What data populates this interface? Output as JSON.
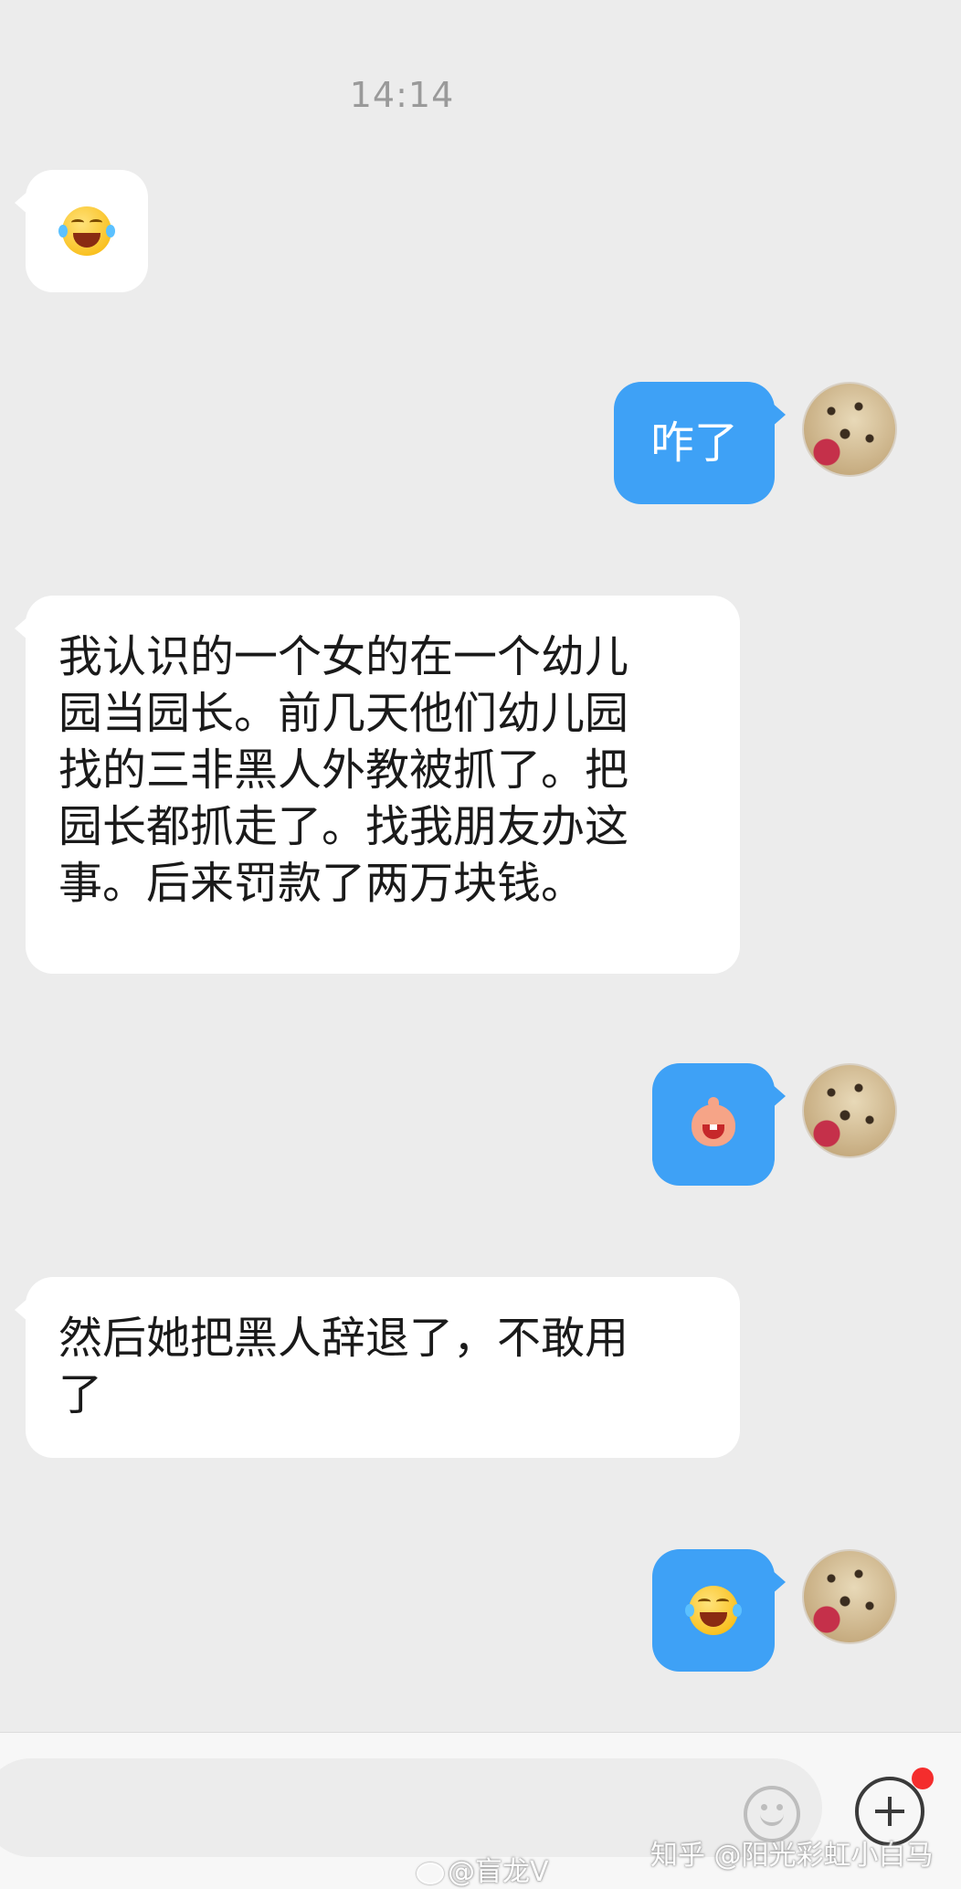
{
  "status": {
    "time": "14:14"
  },
  "messages": [
    {
      "side": "in",
      "type": "emoji",
      "emoji": "laugh-cry-emoji"
    },
    {
      "side": "out",
      "type": "text",
      "text": "咋了"
    },
    {
      "side": "in",
      "type": "text",
      "lines": [
        "我认识的一个女的在一个幼儿",
        "园当园长。前几天他们幼儿园",
        "找的三非黑人外教被抓了。把",
        "园长都抓走了。找我朋友办这",
        "事。后来罚款了两万块钱。"
      ]
    },
    {
      "side": "out",
      "type": "emoji",
      "emoji": "qq-grin-emoji"
    },
    {
      "side": "in",
      "type": "text",
      "lines": [
        "然后她把黑人辞退了，不敢用",
        "了"
      ]
    },
    {
      "side": "out",
      "type": "emoji",
      "emoji": "laugh-cry-emoji"
    }
  ],
  "input_bar": {
    "placeholder": "",
    "emoji_button_icon": "smile-icon",
    "more_button_icon": "plus-icon",
    "badge_color": "#f42d2d"
  },
  "watermarks": {
    "zhihu": "知乎 @阳光彩虹小白马",
    "weibo": "@盲龙V"
  },
  "colors": {
    "background": "#ececec",
    "outgoing_bubble": "#3ea1f6",
    "incoming_bubble": "#ffffff"
  }
}
